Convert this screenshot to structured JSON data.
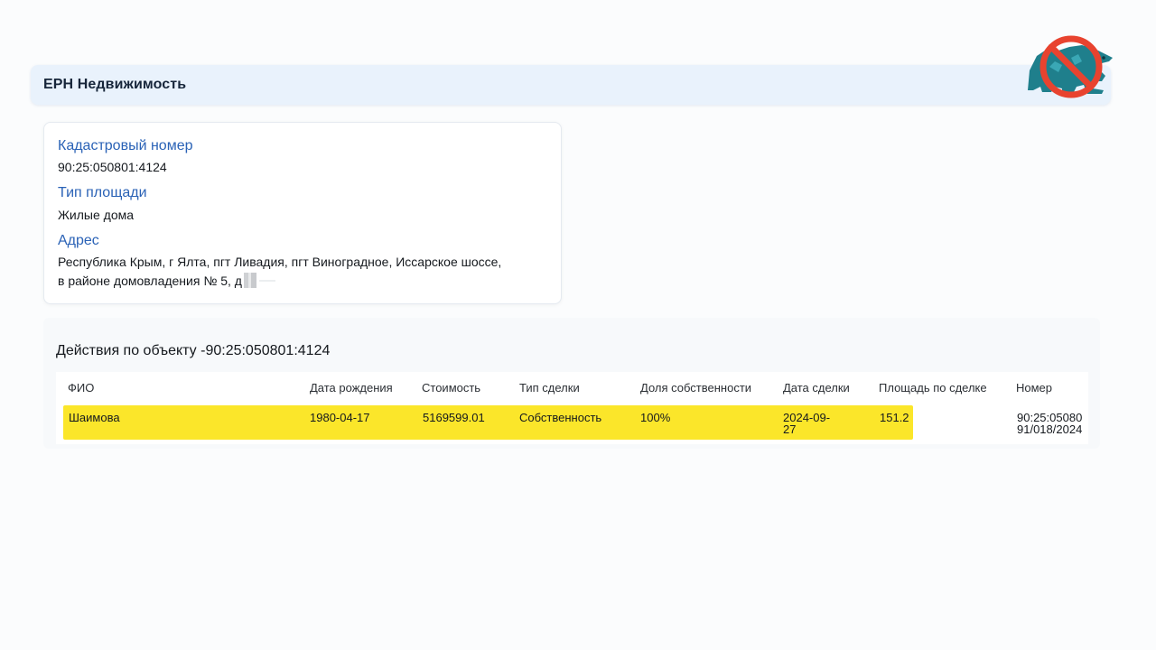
{
  "app": {
    "title": "ЕРН Недвижимость"
  },
  "object_info": {
    "cadastral_label": "Кадастровый номер",
    "cadastral_value": "90:25:050801:4124",
    "area_type_label": "Тип площади",
    "area_type_value": "Жилые дома",
    "address_label": "Адрес",
    "address_line1": "Республика Крым, г Ялта, пгт Ливадия, пгт Виноградное, Иссарское шоссе,",
    "address_line2": "в районе домовладения № 5, д"
  },
  "actions": {
    "title": "Действия по объекту -90:25:050801:4124",
    "columns": [
      "ФИО",
      "Дата рождения",
      "Стоимость",
      "Тип сделки",
      "Доля собственности",
      "Дата сделки",
      "Площадь по сделке",
      "Номер"
    ],
    "rows": [
      {
        "fio": "Шаимова",
        "birth_date": "1980-04-17",
        "price": "5169599.01",
        "deal_type": "Собственность",
        "share": "100%",
        "deal_date_line1": "2024-09-",
        "deal_date_line2": "27",
        "area": "151.2",
        "number_line1": "90:25:05080",
        "number_line2": "91/018/2024"
      }
    ]
  },
  "colors": {
    "accent_label": "#2a62b6",
    "header_bg": "#e9f2fc",
    "row_highlight": "#fbe62a",
    "logo_bear": "#1f7f8c",
    "logo_ban": "#e8432f"
  },
  "icons": {
    "logo": "crossed-out-bear-logo"
  }
}
